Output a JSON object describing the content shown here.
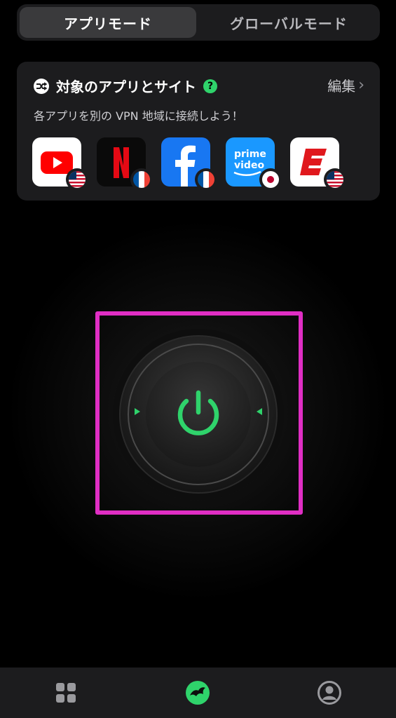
{
  "mode_switch": {
    "app_mode": "アプリモード",
    "global_mode": "グローバルモード",
    "selected": "app_mode"
  },
  "target_card": {
    "title": "対象のアプリとサイト",
    "help": "?",
    "edit_label": "編集",
    "subtitle": "各アプリを別の VPN 地域に接続しよう！",
    "apps": [
      {
        "app": "YouTube",
        "region_flag": "us"
      },
      {
        "app": "Netflix",
        "region_flag": "fr"
      },
      {
        "app": "Facebook",
        "region_flag": "fr"
      },
      {
        "app": "Prime Video",
        "region_flag": "jp"
      },
      {
        "app": "ESPN",
        "region_flag": "us"
      }
    ],
    "prime_text_1": "prime",
    "prime_text_2": "video"
  },
  "power": {
    "state": "disconnected",
    "accent_color": "#2fd36b",
    "highlight_color": "#e02ec4"
  },
  "bottom_nav": {
    "items": [
      "apps-grid-icon",
      "logo-icon",
      "account-icon"
    ]
  }
}
